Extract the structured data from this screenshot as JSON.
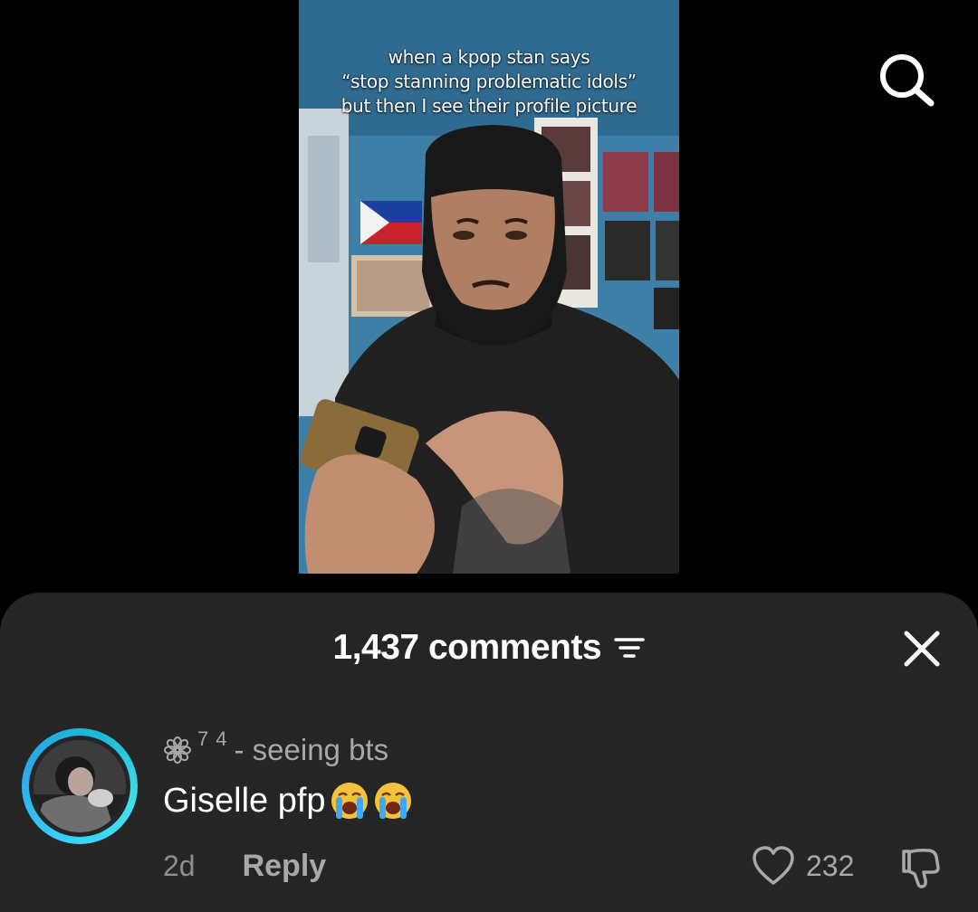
{
  "video": {
    "caption_lines": [
      "when a kpop stan says",
      "“stop stanning problematic idols”",
      "but then I see their profile picture"
    ]
  },
  "icons": {
    "search": "search-icon",
    "sort": "sort-icon",
    "close": "close-icon",
    "like": "heart-icon",
    "dislike": "dislike-icon",
    "flower": "flower-icon"
  },
  "comments_sheet": {
    "count_label": "1,437 comments",
    "comment": {
      "badge_sup_1": "7",
      "badge_sup_2": "4",
      "username_text": "- seeing bts",
      "text": "Giselle pfp",
      "time": "2d",
      "reply_label": "Reply",
      "like_count": "232"
    }
  },
  "colors": {
    "sheet_bg": "#252525",
    "avatar_ring": "#38d0ff",
    "muted_text": "#a8a8a8"
  }
}
